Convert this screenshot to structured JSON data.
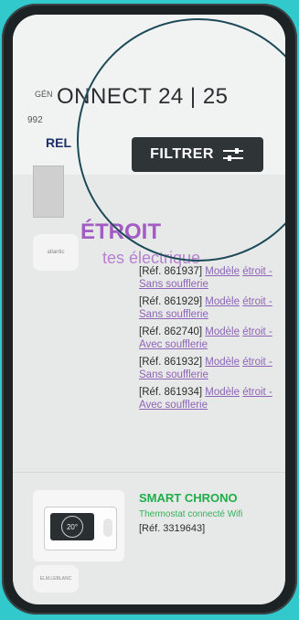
{
  "header": {
    "label_small": "GÉN",
    "number_small": "992",
    "title": "ONNECT 24 | 25",
    "tab_left": "REL",
    "filter_button": "FILTRER"
  },
  "section": {
    "title": "ÉTROIT",
    "subtitle": "tes électrique",
    "brand": "atlantic"
  },
  "refs": [
    {
      "ref": "[Réf. 861937]",
      "model": "Modèle",
      "desc": "étroit - Sans soufflerie"
    },
    {
      "ref": "[Réf. 861929]",
      "model": "Modèle",
      "desc": "étroit - Sans soufflerie"
    },
    {
      "ref": "[Réf. 862740]",
      "model": "Modèle",
      "desc": "étroit - Avec soufflerie"
    },
    {
      "ref": "[Réf. 861932]",
      "model": "Modèle",
      "desc": "étroit - Sans soufflerie"
    },
    {
      "ref": "[Réf. 861934]",
      "model": "Modèle",
      "desc": "étroit - Avec soufflerie"
    }
  ],
  "product2": {
    "name": "SMART CHRONO",
    "desc": "Thermostat connecté Wifi",
    "ref": "[Réf. 3319643]",
    "thermo_display": "20°",
    "brand": "ELM.LEBLANC"
  },
  "colors": {
    "background": "#32c9cc",
    "section_purple": "#a35cc4",
    "product_green": "#1fae4a",
    "button_dark": "#2f3436"
  },
  "icons": [
    "filter-sliders-icon"
  ]
}
